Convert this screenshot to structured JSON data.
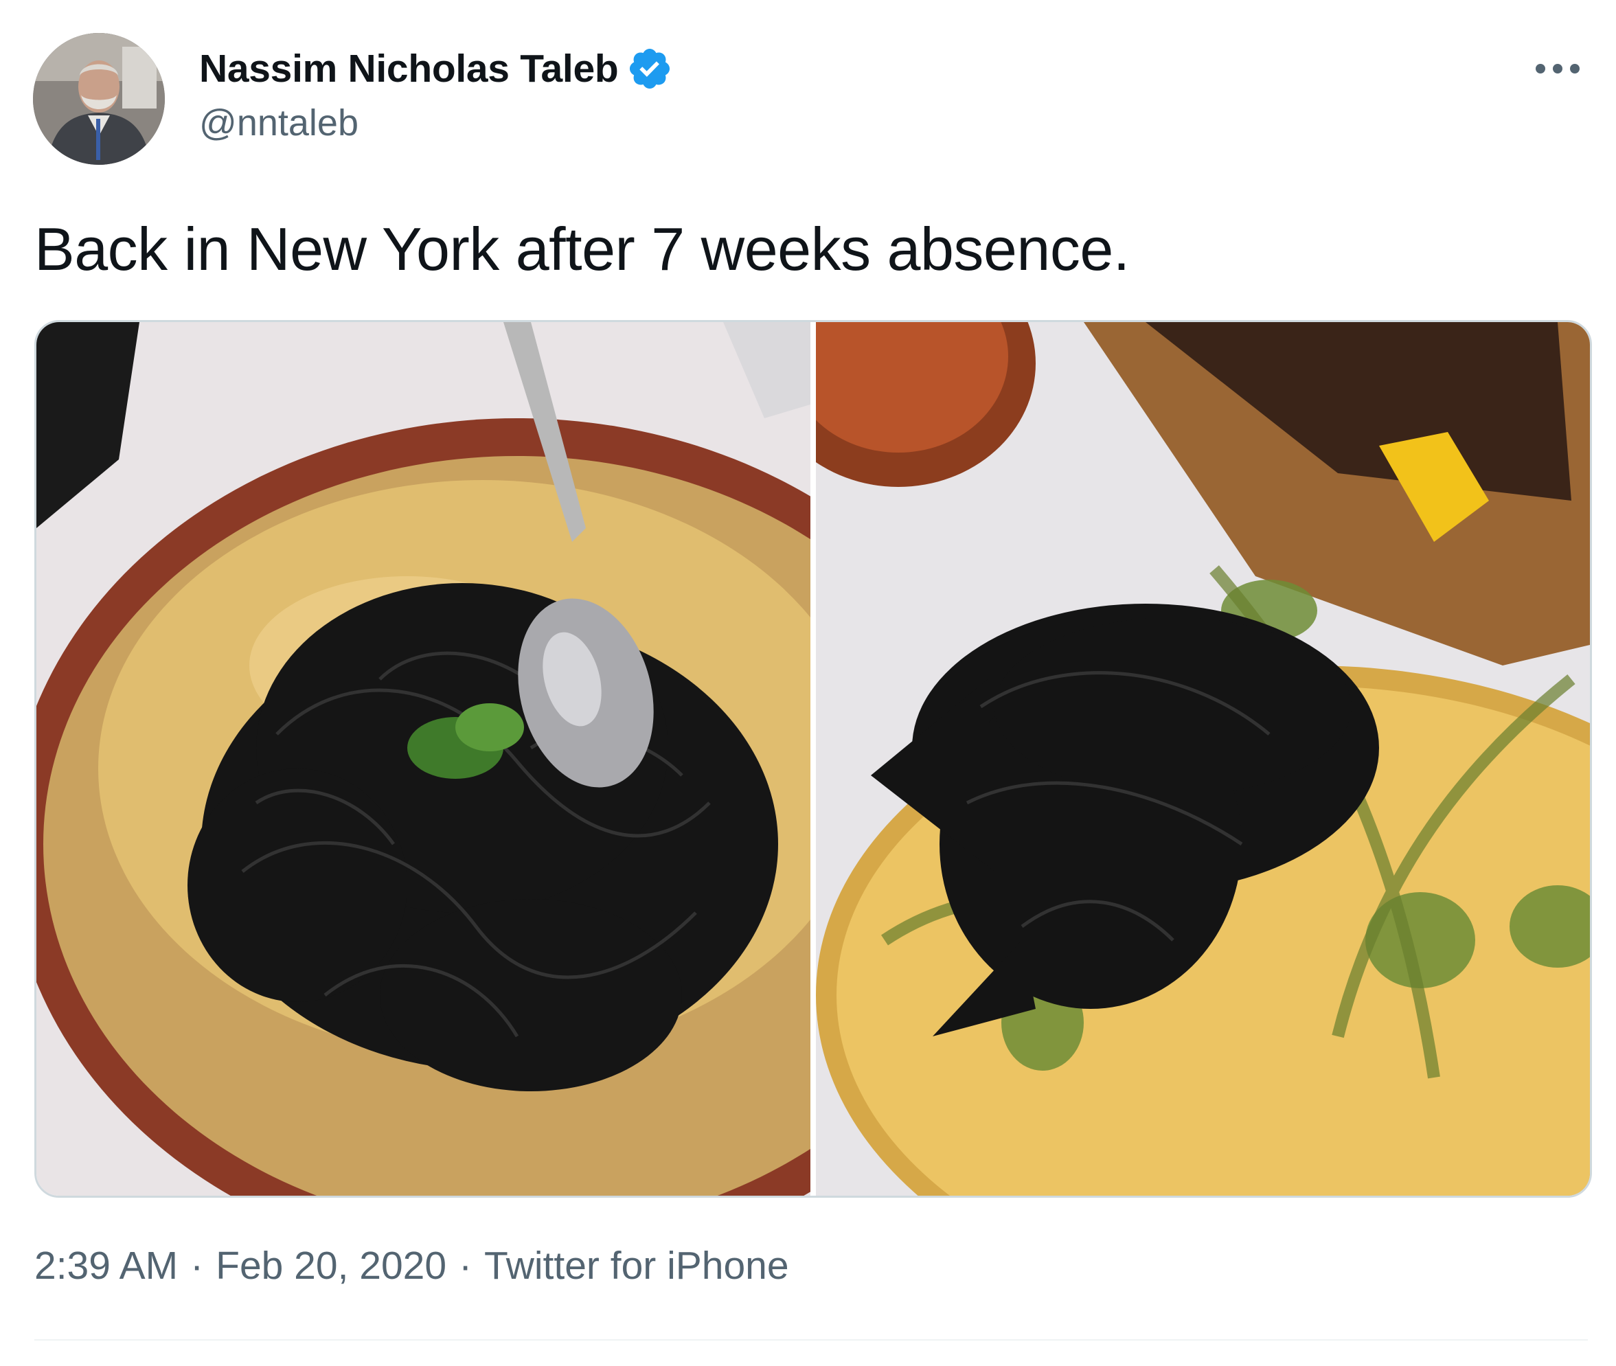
{
  "author": {
    "display_name": "Nassim Nicholas Taleb",
    "handle": "@nntaleb",
    "verified": true,
    "avatar_icon": "user-photo-avatar",
    "verified_icon": "verified-badge-icon",
    "verified_color": "#1d9bf0"
  },
  "more_menu": {
    "icon": "more-horizontal-icon"
  },
  "tweet": {
    "text": "Back in New York after 7 weeks absence.",
    "media": [
      {
        "kind": "photo"
      },
      {
        "kind": "photo"
      }
    ]
  },
  "meta": {
    "time": "2:39 AM",
    "separator": "·",
    "date": "Feb 20, 2020",
    "source": "Twitter for iPhone"
  },
  "colors": {
    "text_primary": "#0f1419",
    "text_secondary": "#536471",
    "border": "#cfd9de"
  }
}
